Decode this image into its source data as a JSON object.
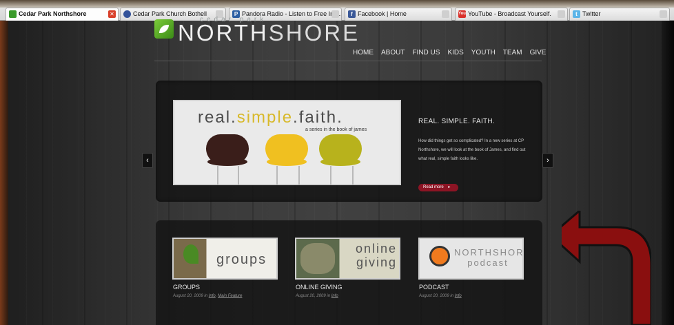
{
  "browser": {
    "tabs": [
      {
        "label": "Cedar Park Northshore",
        "active": true,
        "favicon": "green-leaf-icon",
        "color": "#3a9a2a"
      },
      {
        "label": "Cedar Park Church Bothell",
        "active": false,
        "favicon": "globe-icon",
        "color": "#34539a"
      },
      {
        "label": "Pandora Radio - Listen to Free Inte...",
        "active": false,
        "favicon": "pandora-icon",
        "color": "#2d5fa3"
      },
      {
        "label": "Facebook | Home",
        "active": false,
        "favicon": "facebook-icon",
        "color": "#3b5998"
      },
      {
        "label": "YouTube - Broadcast Yourself.",
        "active": false,
        "favicon": "youtube-icon",
        "color": "#d9302a"
      },
      {
        "label": "Twitter",
        "active": false,
        "favicon": "twitter-icon",
        "color": "#5bb5e8"
      }
    ]
  },
  "logo": {
    "small": "cedar park",
    "main_bold": "NORTH",
    "main_thin": "SHORE"
  },
  "nav": [
    "HOME",
    "ABOUT",
    "FIND US",
    "KIDS",
    "YOUTH",
    "TEAM",
    "GIVE"
  ],
  "slider": {
    "image_title_a": "real.",
    "image_title_b": "simple",
    "image_title_c": ".faith.",
    "image_subtitle": "a series in the book of james",
    "heading": "REAL. SIMPLE. FAITH.",
    "text": "How did things get so complicated? In a new series at CP Northshore, we will look at the book of James, and find out what real, simple faith looks like.",
    "read_more": "Read more",
    "prev": "‹",
    "next": "›"
  },
  "features": [
    {
      "thumb_text": "groups",
      "title": "GROUPS",
      "date": "August 20, 2009 in",
      "tags": [
        "Info",
        "Main Feature"
      ]
    },
    {
      "thumb_text": "online giving",
      "title": "ONLINE GIVING",
      "date": "August 20, 2009 in",
      "tags": [
        "Info"
      ]
    },
    {
      "thumb_text": "NORTHSHORE podcast",
      "title": "PODCAST",
      "date": "August 20, 2009 in",
      "tags": [
        "Info"
      ]
    }
  ],
  "colors": {
    "accent_green": "#5cb82a",
    "read_more": "#8c1424",
    "annotation_arrow": "#8a0f0f"
  }
}
